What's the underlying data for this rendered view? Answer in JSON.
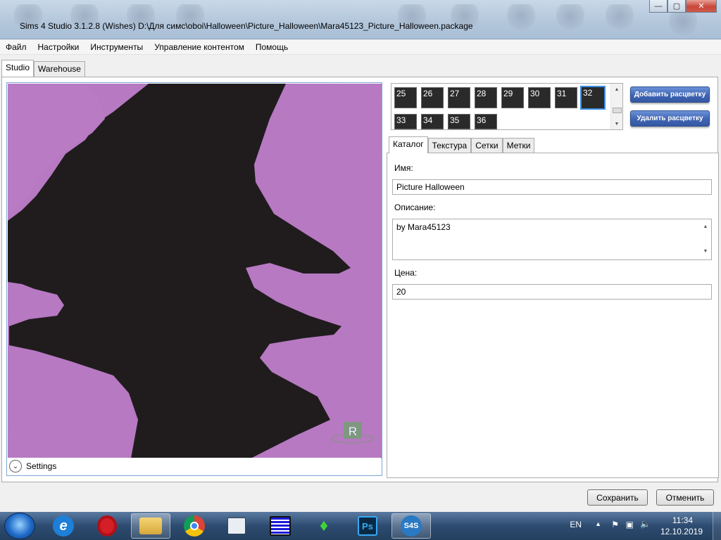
{
  "window": {
    "title": "Sims 4 Studio 3.1.2.8 (Wishes)  D:\\Для симс\\oboi\\Halloween\\Picture_Halloween\\Mara45123_Picture_Halloween.package",
    "minimize": "—",
    "maximize": "▢",
    "close": "✕"
  },
  "menu": [
    "Файл",
    "Настройки",
    "Инструменты",
    "Управление контентом",
    "Помощь"
  ],
  "tabs": [
    "Studio",
    "Warehouse"
  ],
  "preview": {
    "settings_label": "Settings",
    "badge": "R",
    "colors": {
      "background": "#b97bc4",
      "silhouette": "#201c1e"
    }
  },
  "swatches": {
    "items": [
      "25",
      "26",
      "27",
      "28",
      "29",
      "30",
      "31",
      "32",
      "33",
      "34",
      "35",
      "36"
    ],
    "selected": "32"
  },
  "buttons": {
    "add_swatch": "Добавить расцветку",
    "remove_swatch": "Удалить расцветку",
    "save": "Сохранить",
    "cancel": "Отменить"
  },
  "prop_tabs": [
    "Каталог",
    "Текстура",
    "Сетки",
    "Метки"
  ],
  "catalog": {
    "name_label": "Имя:",
    "name_value": "Picture Halloween",
    "desc_label": "Описание:",
    "desc_value": "by Mara45123",
    "price_label": "Цена:",
    "price_value": "20"
  },
  "taskbar": {
    "apps": [
      "windows-start",
      "internet-explorer",
      "opera",
      "file-explorer",
      "chrome",
      "notepad-app",
      "calculator-app",
      "sims4",
      "photoshop",
      "sims4-studio"
    ],
    "ps_label": "Ps",
    "s4s_label": "S4S",
    "lang": "EN",
    "time": "11:34",
    "date": "12.10.2019"
  }
}
